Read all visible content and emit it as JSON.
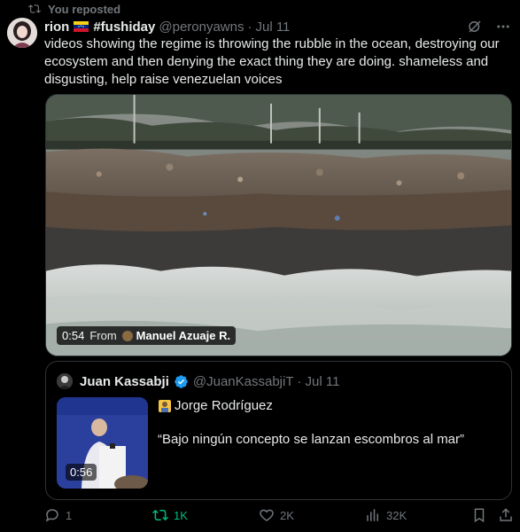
{
  "repost_line": {
    "icon": "repost-icon",
    "text": "You reposted"
  },
  "tweet": {
    "author_name": "rion",
    "author_suffix": "#fushiday",
    "handle": "@peronyawns",
    "separator": "·",
    "time": "Jul 11",
    "text": "videos showing the regime is throwing the rubble in the ocean, destroying our ecosystem and then denying the exact thing they are doing. shameless and disgusting, help raise venezuelan voices"
  },
  "video": {
    "duration": "0:54",
    "from_label": "From",
    "source_name": "Manuel Azuaje R."
  },
  "quote": {
    "author_name": "Juan Kassabji",
    "handle": "@JuanKassabjiT",
    "separator": "·",
    "time": "Jul 11",
    "line1": "Jorge Rodríguez",
    "line2": "“Bajo ningún concepto se lanzan escombros al mar”",
    "thumb_duration": "0:56"
  },
  "actions": {
    "reply_count": "1",
    "repost_count": "1K",
    "like_count": "2K",
    "views_count": "32K"
  },
  "colors": {
    "background": "#000000",
    "text": "#e7e9ea",
    "muted": "#71767b",
    "repost_active": "#00ba7c",
    "verified": "#1d9bf0",
    "border": "#2f3336"
  }
}
